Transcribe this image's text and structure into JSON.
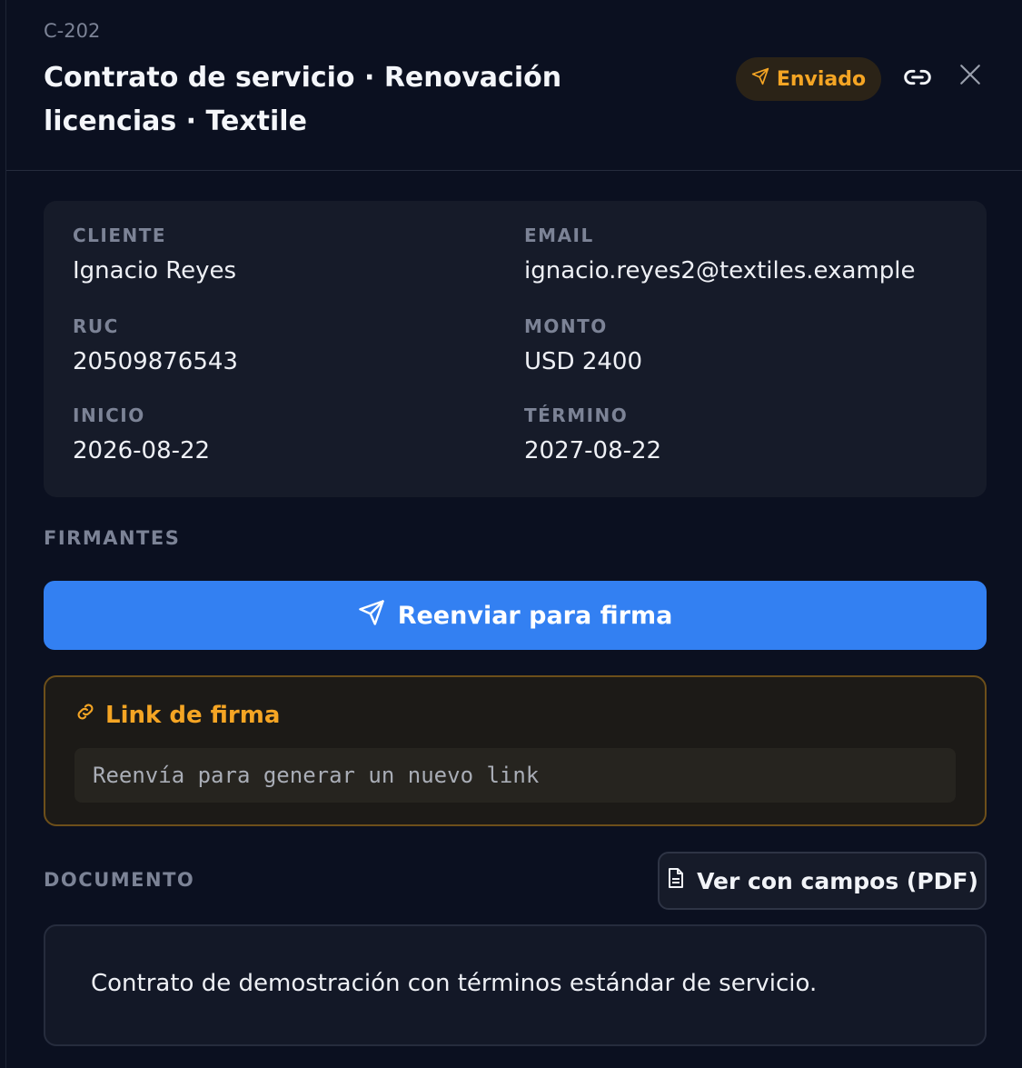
{
  "header": {
    "contract_id": "C-202",
    "title": "Contrato de servicio · Renovación licencias · Textile",
    "status": "Enviado",
    "status_icon": "send-icon",
    "copy_link_icon": "link-icon",
    "close_icon": "close-icon"
  },
  "info": {
    "cliente_label": "CLIENTE",
    "cliente_value": "Ignacio Reyes",
    "email_label": "EMAIL",
    "email_value": "ignacio.reyes2@textiles.example",
    "ruc_label": "RUC",
    "ruc_value": "20509876543",
    "monto_label": "MONTO",
    "monto_value": "USD 2400",
    "inicio_label": "INICIO",
    "inicio_value": "2026-08-22",
    "termino_label": "TÉRMINO",
    "termino_value": "2027-08-22"
  },
  "signers": {
    "section_label": "FIRMANTES",
    "resend_button": "Reenviar para firma"
  },
  "sign_link": {
    "title": "Link de firma",
    "message": "Reenvía para generar un nuevo link"
  },
  "document": {
    "section_label": "DOCUMENTO",
    "view_pdf_button": "Ver con campos (PDF)",
    "description": "Contrato de demostración con términos estándar de servicio."
  },
  "colors": {
    "accent": "#3380f2",
    "warning": "#f5a524",
    "background": "#0b1020"
  }
}
